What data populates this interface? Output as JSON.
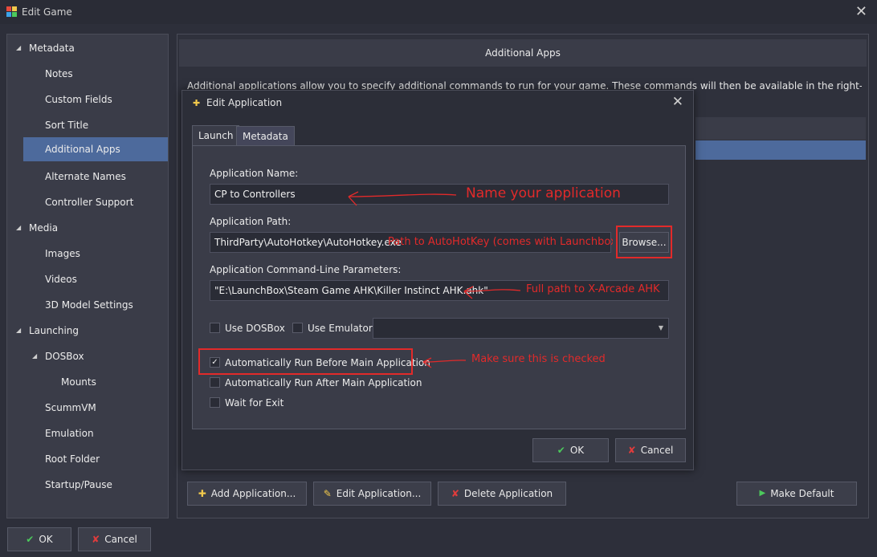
{
  "window": {
    "title": "Edit Game",
    "close_icon": "close-icon"
  },
  "sidebar": {
    "items": [
      {
        "label": "Metadata",
        "level": 0,
        "expanded": true
      },
      {
        "label": "Notes",
        "level": 1
      },
      {
        "label": "Custom Fields",
        "level": 1
      },
      {
        "label": "Sort Title",
        "level": 1
      },
      {
        "label": "Additional Apps",
        "level": 1,
        "selected": true
      },
      {
        "label": "Alternate Names",
        "level": 1
      },
      {
        "label": "Controller Support",
        "level": 1
      },
      {
        "label": "Media",
        "level": 0,
        "expanded": true
      },
      {
        "label": "Images",
        "level": 1
      },
      {
        "label": "Videos",
        "level": 1
      },
      {
        "label": "3D Model Settings",
        "level": 1
      },
      {
        "label": "Launching",
        "level": 0,
        "expanded": true
      },
      {
        "label": "DOSBox",
        "level": 1,
        "expanded": true
      },
      {
        "label": "Mounts",
        "level": 2
      },
      {
        "label": "ScummVM",
        "level": 1
      },
      {
        "label": "Emulation",
        "level": 1
      },
      {
        "label": "Root Folder",
        "level": 1
      },
      {
        "label": "Startup/Pause",
        "level": 1
      }
    ]
  },
  "main": {
    "header": "Additional Apps",
    "description": "Additional applications allow you to specify additional commands to run for your game.  These commands will then be available in the right-click menu for",
    "buttons": {
      "add": "Add Application...",
      "edit": "Edit Application...",
      "delete": "Delete Application",
      "make_default": "Make Default"
    }
  },
  "footer": {
    "ok": "OK",
    "cancel": "Cancel"
  },
  "dialog": {
    "title": "Edit Application",
    "tabs": [
      "Launch",
      "Metadata"
    ],
    "active_tab": "Launch",
    "app_name_label": "Application Name:",
    "app_name_value": "CP to Controllers",
    "app_path_label": "Application Path:",
    "app_path_value": "ThirdParty\\AutoHotkey\\AutoHotkey.exe",
    "browse": "Browse...",
    "params_label": "Application Command-Line Parameters:",
    "params_value": "\"E:\\LaunchBox\\Steam Game AHK\\Killer Instinct AHK.ahk\"",
    "use_dosbox": "Use DOSBox",
    "use_emulator": "Use Emulator:",
    "emulator_value": "",
    "auto_before": "Automatically Run Before Main Application",
    "auto_after": "Automatically Run After Main Application",
    "wait_exit": "Wait for Exit",
    "checks": {
      "use_dosbox": false,
      "use_emulator": false,
      "auto_before": true,
      "auto_after": false,
      "wait_exit": false
    },
    "ok": "OK",
    "cancel": "Cancel"
  },
  "annotations": {
    "name": "Name your application",
    "path": "Path to AutoHotKey (comes with Launchbox)",
    "params": "Full path to X-Arcade AHK",
    "checked": "Make sure this is checked"
  },
  "colors": {
    "annotation": "#e22a2a",
    "selection": "#4d6a9c",
    "background": "#2d2f3a"
  }
}
